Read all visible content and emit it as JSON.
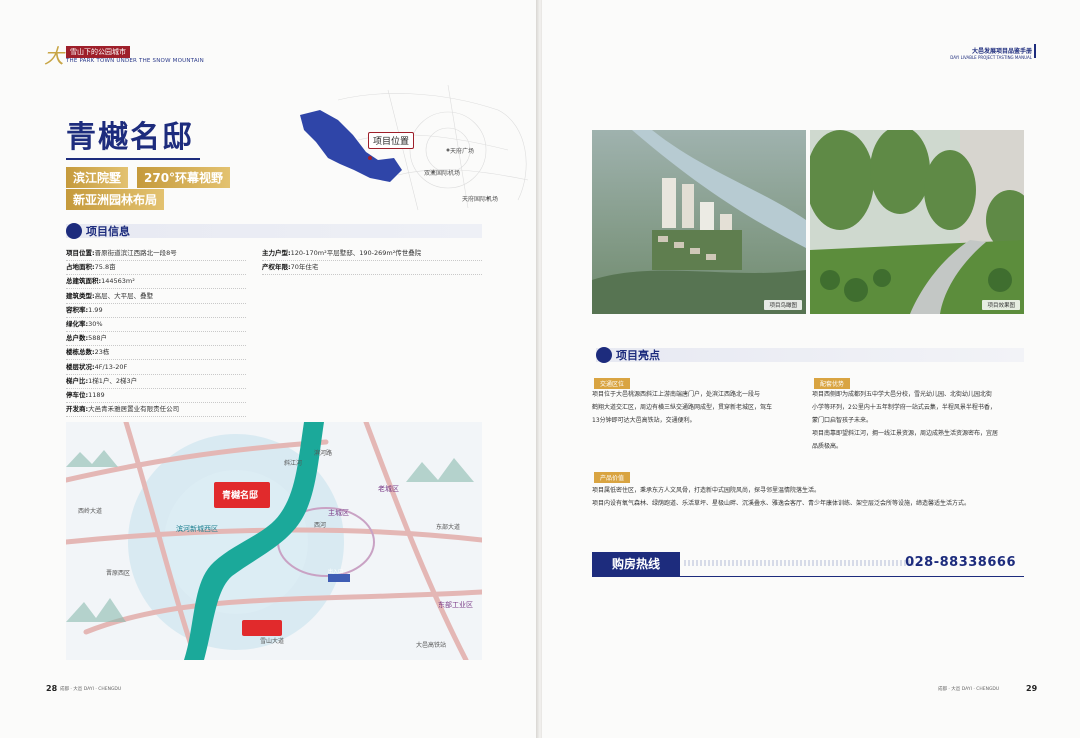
{
  "left_page": {
    "header": {
      "logo_char": "大",
      "badge": "雪山下的公园城市",
      "subtitle": "THE PARK TOWN UNDER THE SNOW MOUNTAIN"
    },
    "title": "青樾名邸",
    "tags": [
      "滨江院墅",
      "270°环幕视野",
      "新亚洲园林布局"
    ],
    "location_map": {
      "callout": "项目位置",
      "labels": [
        "天府广场",
        "双流国际机场",
        "天府国际机场"
      ]
    },
    "section_info_title": "项目信息",
    "info_left": [
      {
        "k": "项目位置:",
        "v": "晋原街道滨江西路北一段8号"
      },
      {
        "k": "占地面积:",
        "v": "75.8亩"
      },
      {
        "k": "总建筑面积:",
        "v": "144563m²"
      },
      {
        "k": "建筑类型:",
        "v": "高层、大平层、叠墅"
      },
      {
        "k": "容积率:",
        "v": "1.99"
      },
      {
        "k": "绿化率:",
        "v": "30%"
      },
      {
        "k": "总户数:",
        "v": "588户"
      },
      {
        "k": "楼栋总数:",
        "v": "23栋"
      },
      {
        "k": "楼层状况:",
        "v": "4F/13-20F"
      },
      {
        "k": "梯户比:",
        "v": "1梯1户、2梯3户"
      },
      {
        "k": "停车位:",
        "v": "1189"
      },
      {
        "k": "开发商:",
        "v": "大邑青禾雅居置业有限责任公司"
      }
    ],
    "info_right": [
      {
        "k": "主力户型:",
        "v": "120-170m²平层墅邸、190-269m²传世叠院"
      },
      {
        "k": "产权年限:",
        "v": "70年住宅"
      }
    ],
    "district_map": {
      "project_badge": "青樾名邸",
      "labels": [
        "滨河新城西区",
        "主城区",
        "老城区",
        "东部工业区",
        "滨河路",
        "西河",
        "斜江河",
        "晋原西区",
        "西岭大道",
        "雪山大道",
        "东部大道",
        "大邑高铁站",
        "出入口"
      ]
    },
    "footer": {
      "page": "28",
      "text": "成都 · 大邑 DAYI · CHENGDU"
    }
  },
  "right_page": {
    "header": {
      "cn": "大邑发展项目品鉴手册",
      "en": "DAYI LIVABLE PROJECT TASTING MANUAL"
    },
    "photos": [
      {
        "caption": "项目鸟瞰图"
      },
      {
        "caption": "项目效果图"
      }
    ],
    "section_highlights_title": "项目亮点",
    "highlights": {
      "traffic": {
        "tag": "交通区位",
        "lines": [
          "项目位于大邑桃源西斜江上游南端唐门户，处滨江西路北一段与",
          "鹤翔大道交汇区，周边有横三纵交通路网成型，贯穿新老城区，驾车",
          "13分钟即可达大邑高铁站，交通便利。"
        ]
      },
      "education": {
        "tag": "配套优势",
        "lines": [
          "项目西侧即为成都列五中学大邑分校，雪光幼儿园、北街幼儿园北街",
          "小学等环列，2公里内十五年制学府一站式云集，半程风景半程书香，",
          "蒙门口启智孩子未来。",
          "项目南靠即望斜江河，拥一线江景资源，周边成熟生活资源密布，宜居",
          "品质极高。"
        ]
      },
      "product": {
        "tag": "产品价值",
        "lines": [
          "项目属低密住区，秉承东方人文风骨，打造新中式园院风尚，探寻邻里温情院落生活。",
          "项目内设有氧气森林、绿荫跑道、乐活草坪、星极山畔、沉溪叠水、雅逸会客厅、青少年康体训练、架空层泛会所等设施，缔造馨适生活方式。"
        ]
      }
    },
    "hotline": {
      "label": "购房热线",
      "number": "028-88338666"
    },
    "footer": {
      "page": "29",
      "text": "成都 · 大邑 DAYI · CHENGDU"
    }
  }
}
